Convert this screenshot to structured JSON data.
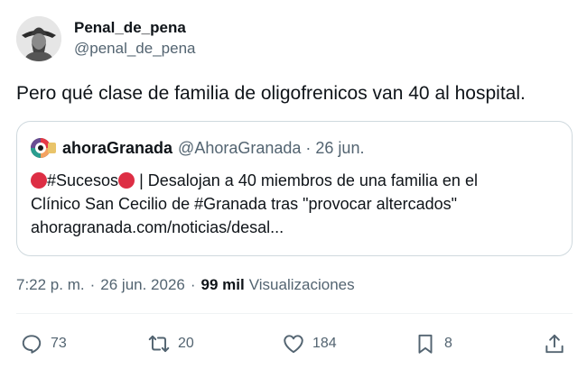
{
  "author": {
    "display_name": "Penal_de_pena",
    "handle": "@penal_de_pena"
  },
  "tweet": {
    "text": "Pero qué clase de familia de oligofrenicos van 40 al hospital."
  },
  "quote": {
    "display_name": "ahoraGranada",
    "handle": "@AhoraGranada",
    "separator": "·",
    "date": "26 jun.",
    "line1_tag": "#Sucesos",
    "line1_text": "| Desalojan a 40 miembros de una familia en el",
    "line2": "Clínico San Cecilio de #Granada tras \"provocar altercados\"",
    "line3": "ahoragranada.com/noticias/desal..."
  },
  "meta": {
    "time": "7:22 p. m.",
    "separator": "·",
    "date": "26 jun. 2026",
    "separator2": "·",
    "views_count": "99 mil",
    "views_label": "Visualizaciones"
  },
  "actions": {
    "reply_count": "73",
    "retweet_count": "20",
    "like_count": "184",
    "bookmark_count": "8"
  },
  "colors": {
    "text": "#0f1419",
    "secondary": "#536471",
    "border": "#cfd9de",
    "emoji_red": "#dd2e44"
  },
  "icons": [
    "reply-icon",
    "retweet-icon",
    "like-icon",
    "bookmark-icon",
    "share-icon"
  ]
}
